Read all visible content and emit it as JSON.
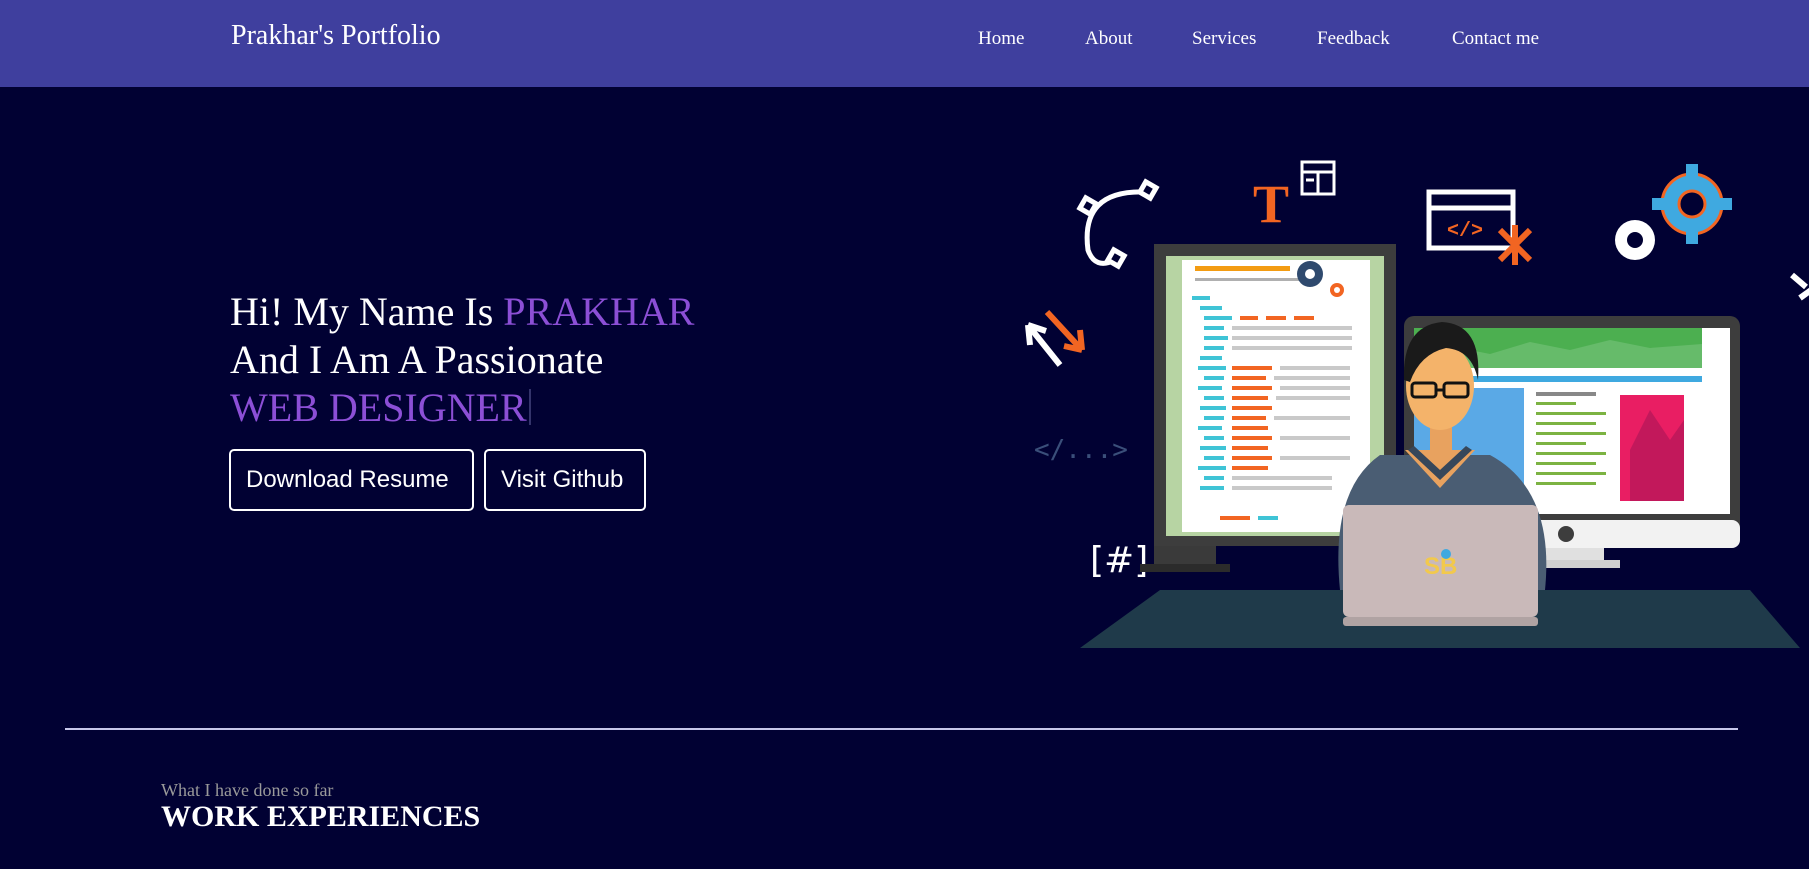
{
  "navbar": {
    "brand": "Prakhar's Portfolio",
    "links": [
      "Home",
      "About",
      "Services",
      "Feedback",
      "Contact me"
    ]
  },
  "hero": {
    "line1_prefix": "Hi! My Name Is ",
    "name": "PRAKHAR",
    "line2": "And I Am A Passionate",
    "role": "WEB DESIGNER",
    "buttons": {
      "resume": "Download Resume",
      "github": "Visit Github"
    }
  },
  "illustration": {
    "code_tag": "</...>",
    "hash_tag": "[#]",
    "text_t": "T",
    "code_window": "</>",
    "laptop_logo": "SB"
  },
  "experience": {
    "subtitle": "What I have done so far",
    "title": "WORK EXPERIENCES"
  },
  "colors": {
    "navbar_bg": "#3f3f9e",
    "page_bg": "#010133",
    "accent": "#8c4fd6",
    "orange": "#f26522",
    "blue": "#3fa9e0"
  }
}
